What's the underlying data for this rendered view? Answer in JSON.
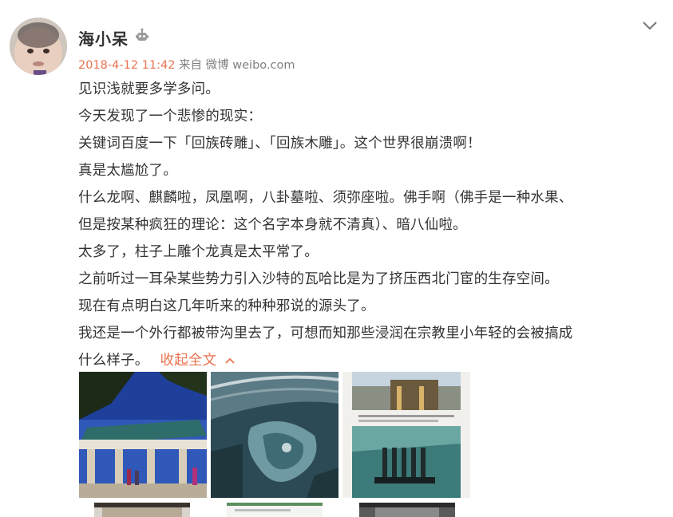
{
  "post": {
    "author": "海小呆",
    "timestamp": "2018-4-12 11:42",
    "source_prefix": "来自",
    "source": "微博 weibo.com",
    "lines": [
      "见识浅就要多学多问。",
      "今天发现了一个悲惨的现实：",
      "关键词百度一下「回族砖雕」、「回族木雕」。这个世界很崩溃啊！",
      "真是太尴尬了。",
      "什么龙啊、麒麟啦，凤凰啊，八卦墓啦、须弥座啦。佛手啊（佛手是一种水果、",
      "但是按某种疯狂的理论：这个名字本身就不清真）、暗八仙啦。",
      "太多了，柱子上雕个龙真是太平常了。",
      "之前听过一耳朵某些势力引入沙特的瓦哈比是为了挤压西北门宦的生存空间。",
      "现在有点明白这几年听来的种种邪说的源头了。",
      "我还是一个外行都被带沟里去了，可想而知那些浸润在宗教里小年轻的会被搞成"
    ],
    "last_line": "什么样子。",
    "collapse_label": "收起全文"
  },
  "colors": {
    "link": "#eb7350",
    "meta": "#808080",
    "text": "#333333"
  },
  "icons": {
    "author_badge": "robot-icon",
    "menu": "chevron-down-icon",
    "collapse": "chevron-up-icon"
  }
}
